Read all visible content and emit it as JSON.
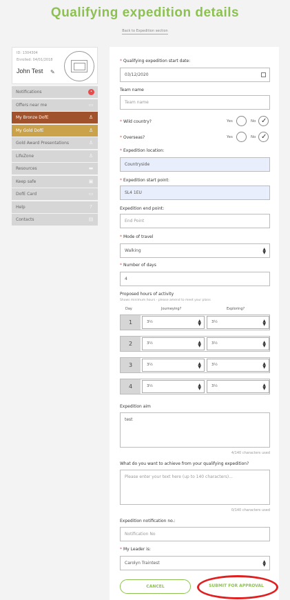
{
  "page": {
    "title": "Qualifying expedition details",
    "back_link": "Back to Expedition section"
  },
  "profile": {
    "id": "ID: 1304304",
    "enrolled": "Enrolled: 04/01/2018",
    "name": "John Test"
  },
  "sidebar": {
    "items": [
      {
        "label": "Notifications",
        "icon": "notification-badge"
      },
      {
        "label": "Offers near me",
        "icon": "offers-icon"
      },
      {
        "label": "My Bronze DofE",
        "icon": "award-icon"
      },
      {
        "label": "My Gold DofE",
        "icon": "award-icon"
      },
      {
        "label": "Gold Award Presentations",
        "icon": "award-icon"
      },
      {
        "label": "LifeZone",
        "icon": "lifezone-icon"
      },
      {
        "label": "Resources",
        "icon": "folder-icon"
      },
      {
        "label": "Keep safe",
        "icon": "lock-icon"
      },
      {
        "label": "DofE Card",
        "icon": "card-icon"
      },
      {
        "label": "Help",
        "icon": "help-icon"
      },
      {
        "label": "Contacts",
        "icon": "contacts-icon"
      }
    ],
    "colors": {
      "bronze": "#a0522d",
      "gold": "#c9a24a",
      "default": "#d6d6d6"
    }
  },
  "form": {
    "start_date_label": "Qualifying expedition start date:",
    "start_date_value": "03/12/2020",
    "team_name_label": "Team name",
    "team_name_placeholder": "Team name",
    "wild_country_label": "Wild country?",
    "overseas_label": "Overseas?",
    "yes": "Yes",
    "no": "No",
    "location_label": "Expedition location:",
    "location_value": "Countryside",
    "start_point_label": "Expedition start point:",
    "start_point_value": "SL4 1EU",
    "end_point_label": "Expedition end point:",
    "end_point_placeholder": "End Point",
    "mode_label": "Mode of travel",
    "mode_value": "Walking",
    "days_label": "Number of days",
    "days_value": "4",
    "hours_label": "Proposed hours of activity",
    "hours_hint": "Shows minimum hours - please amend to meet your plans",
    "col_day": "Day",
    "col_journeying": "Journeying?",
    "col_exploring": "Exploring?",
    "days": [
      {
        "num": "1",
        "journeying": "3½",
        "exploring": "3½"
      },
      {
        "num": "2",
        "journeying": "3½",
        "exploring": "3½"
      },
      {
        "num": "3",
        "journeying": "3½",
        "exploring": "3½"
      },
      {
        "num": "4",
        "journeying": "3½",
        "exploring": "3½"
      }
    ],
    "aim_label": "Expedition aim",
    "aim_value": "test",
    "aim_count": "4/140 characters used",
    "achieve_label": "What do you want to achieve from your qualifying expedition?",
    "achieve_placeholder": "Please enter your text here (up to 140 characters)...",
    "achieve_count": "0/140 characters used",
    "notification_label": "Expedition notification no.:",
    "notification_placeholder": "Notification No",
    "leader_label": "My Leader is:",
    "leader_value": "Carolyn Traintest",
    "cancel_label": "CANCEL",
    "submit_label": "SUBMIT FOR APPROVAL"
  },
  "colors": {
    "accent": "#8cc152",
    "required": "#e84b4b",
    "highlight": "#e02020"
  }
}
